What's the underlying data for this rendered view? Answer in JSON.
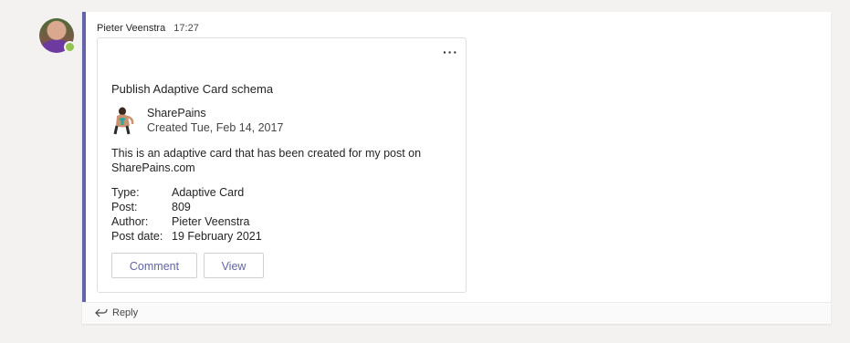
{
  "message": {
    "author": "Pieter Veenstra",
    "time": "17:27"
  },
  "card": {
    "title": "Publish Adaptive Card schema",
    "brand": {
      "name": "SharePains",
      "created": "Created Tue, Feb 14, 2017",
      "icon": "person-back-icon"
    },
    "description": "This is an adaptive card that has been created for my post on SharePains.com",
    "facts": [
      {
        "key": "Type:",
        "value": "Adaptive Card"
      },
      {
        "key": "Post:",
        "value": "809"
      },
      {
        "key": "Author:",
        "value": "Pieter Veenstra"
      },
      {
        "key": "Post date:",
        "value": "19 February 2021"
      }
    ],
    "actions": {
      "comment": "Comment",
      "view": "View"
    },
    "more_label": "···"
  },
  "reply": {
    "label": "Reply",
    "icon": "reply-icon"
  },
  "colors": {
    "accent": "#6264a7",
    "presence": "#92c353"
  }
}
